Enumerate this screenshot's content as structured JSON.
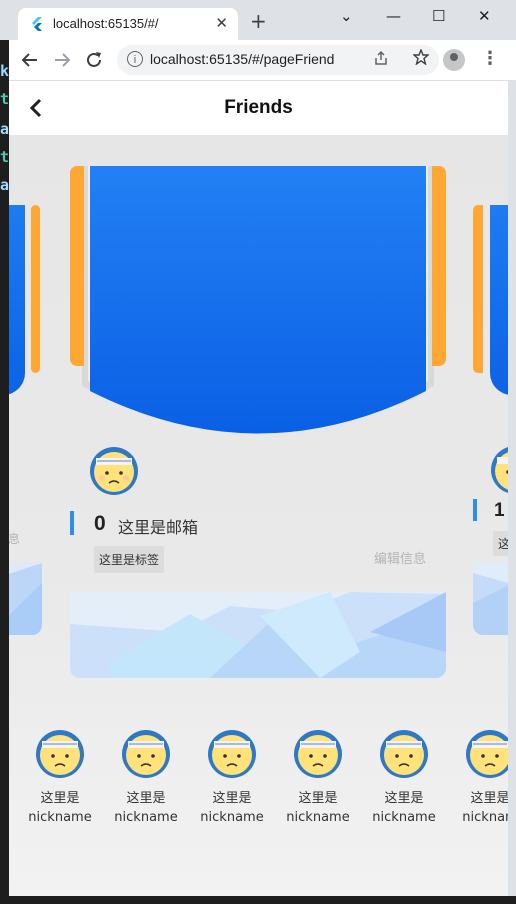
{
  "browser": {
    "tab_title": "localhost:65135/#/",
    "tab_close": "✕",
    "new_tab": "+",
    "url": "localhost:65135/#/pageFriend",
    "window_controls": {
      "minimize": "⌄",
      "restore": "—",
      "maximize": "☐",
      "close": "✕"
    }
  },
  "appbar": {
    "back": "‹",
    "title": "Friends"
  },
  "cards": {
    "main": {
      "count": "0",
      "email": "这里是邮箱",
      "tag": "这里是标签",
      "edit": "编辑信息"
    },
    "left": {
      "edit": "信息"
    },
    "right": {
      "count": "1",
      "tag": "这"
    }
  },
  "friends": [
    {
      "name_line1": "这里是",
      "name_line2": "nickname"
    },
    {
      "name_line1": "这里是",
      "name_line2": "nickname"
    },
    {
      "name_line1": "这里是",
      "name_line2": "nickname"
    },
    {
      "name_line1": "这里是",
      "name_line2": "nickname"
    },
    {
      "name_line1": "这里是",
      "name_line2": "nickname"
    },
    {
      "name_line1": "这里是",
      "name_line2": "nicknam"
    }
  ],
  "colors": {
    "banner": "#1a73f0",
    "tab_orange": "#ffa733",
    "accent_bar": "#2e8fe8",
    "avatar_ring": "#2f78c8",
    "avatar_face": "#ffe27a"
  },
  "icons": [
    "flutter-favicon",
    "back-arrow-icon",
    "forward-arrow-icon",
    "reload-icon",
    "info-icon",
    "share-icon",
    "star-icon",
    "profile-icon",
    "menu-icon",
    "back-chevron-icon",
    "avatar-face-icon"
  ]
}
